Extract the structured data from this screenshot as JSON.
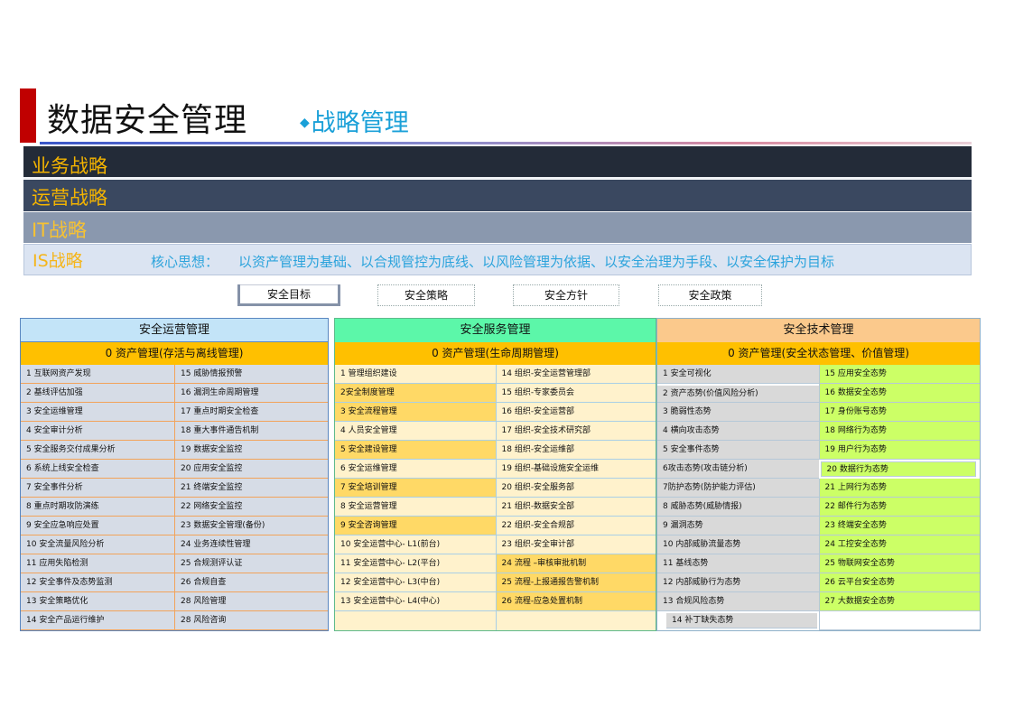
{
  "header": {
    "title": "数据安全管理",
    "subtitle": "战略管理",
    "diamond": "◆"
  },
  "bands": {
    "business": "业务战略",
    "operations": "运营战略",
    "it": "IT战略",
    "is": "IS战略",
    "core_label": "核心思想：",
    "core_text": "以资产管理为基础、以合规管控为底线、以风险管理为依据、以安全治理为手段、以安全保护为目标"
  },
  "tabs": [
    "安全目标",
    "安全策略",
    "安全方针",
    "安全政策"
  ],
  "ops": {
    "title": "安全运营管理",
    "sub": "0 资产管理(存活与离线管理)",
    "col1": [
      "1 互联网资产发现",
      "2 基线评估加强",
      "3 安全运维管理",
      "4 安全审计分析",
      "5 安全服务交付成果分析",
      "6 系统上线安全检查",
      "7 安全事件分析",
      "8 重点时期攻防演练",
      "9 安全应急响应处置",
      "10 安全流量风险分析",
      "11 应用失陷检测",
      "12 安全事件及态势监测",
      "13 安全策略优化",
      "14 安全产品运行维护"
    ],
    "col2": [
      "15 威胁情报预警",
      "16 漏洞生命周期管理",
      "17 重点时期安全检查",
      "18 重大事件通告机制",
      "19 数据安全监控",
      "20 应用安全监控",
      "21 终端安全监控",
      "22 网络安全监控",
      "23 数据安全管理(备份)",
      "24 业务连续性管理",
      "25 合规测评认证",
      "26 合规自查",
      "28 风险管理",
      "28 风险咨询"
    ]
  },
  "service": {
    "title": "安全服务管理",
    "sub": "0 资产管理(生命周期管理)",
    "col1": [
      "1 管理组织建设",
      "2安全制度管理",
      "3 安全流程管理",
      "4 人员安全管理",
      "5 安全建设管理",
      "6 安全运维管理",
      "7 安全培训管理",
      "8 安全运营管理",
      "9 安全咨询管理",
      "10 安全运营中心- L1(前台)",
      "11 安全运营中心- L2(平台)",
      "12 安全运营中心- L3(中台)",
      "13 安全运营中心- L4(中心)"
    ],
    "col2": [
      "14 组织-安全运营管理部",
      "15 组织-专家委员会",
      "16 组织-安全运营部",
      "17 组织-安全技术研究部",
      "18 组织-安全运维部",
      "19 组织-基础设施安全运维",
      "20 组织-安全服务部",
      "21 组织-数据安全部",
      "22 组织-安全合规部",
      "23 组织-安全审计部",
      "24 流程 –审核审批机制",
      "25 流程-上报通报告警机制",
      "26 流程-应急处置机制"
    ]
  },
  "tech": {
    "title": "安全技术管理",
    "sub": "0 资产管理(安全状态管理、价值管理)",
    "col1": [
      "1 安全可视化",
      "2 资产态势(价值风险分析)",
      "3 脆弱性态势",
      "4 横向攻击态势",
      "5 安全事件态势",
      "6攻击态势(攻击链分析)",
      "7防护态势(防护能力评估)",
      "8 威胁态势(威胁情报)",
      "9 漏洞态势",
      "10 内部威胁流量态势",
      "11 基线态势",
      "12 内部威胁行为态势",
      "13 合规风险态势",
      "14 补丁缺失态势"
    ],
    "col2": [
      "15 应用安全态势",
      "16 数据安全态势",
      "17 身份账号态势",
      "18 网络行为态势",
      "19 用户行为态势",
      "20  数据行为态势",
      "21 上网行为态势",
      "22 邮件行为态势",
      "23 终端安全态势",
      "24 工控安全态势",
      "25 物联网安全态势",
      "26 云平台安全态势",
      "27 大数据安全态势"
    ]
  }
}
